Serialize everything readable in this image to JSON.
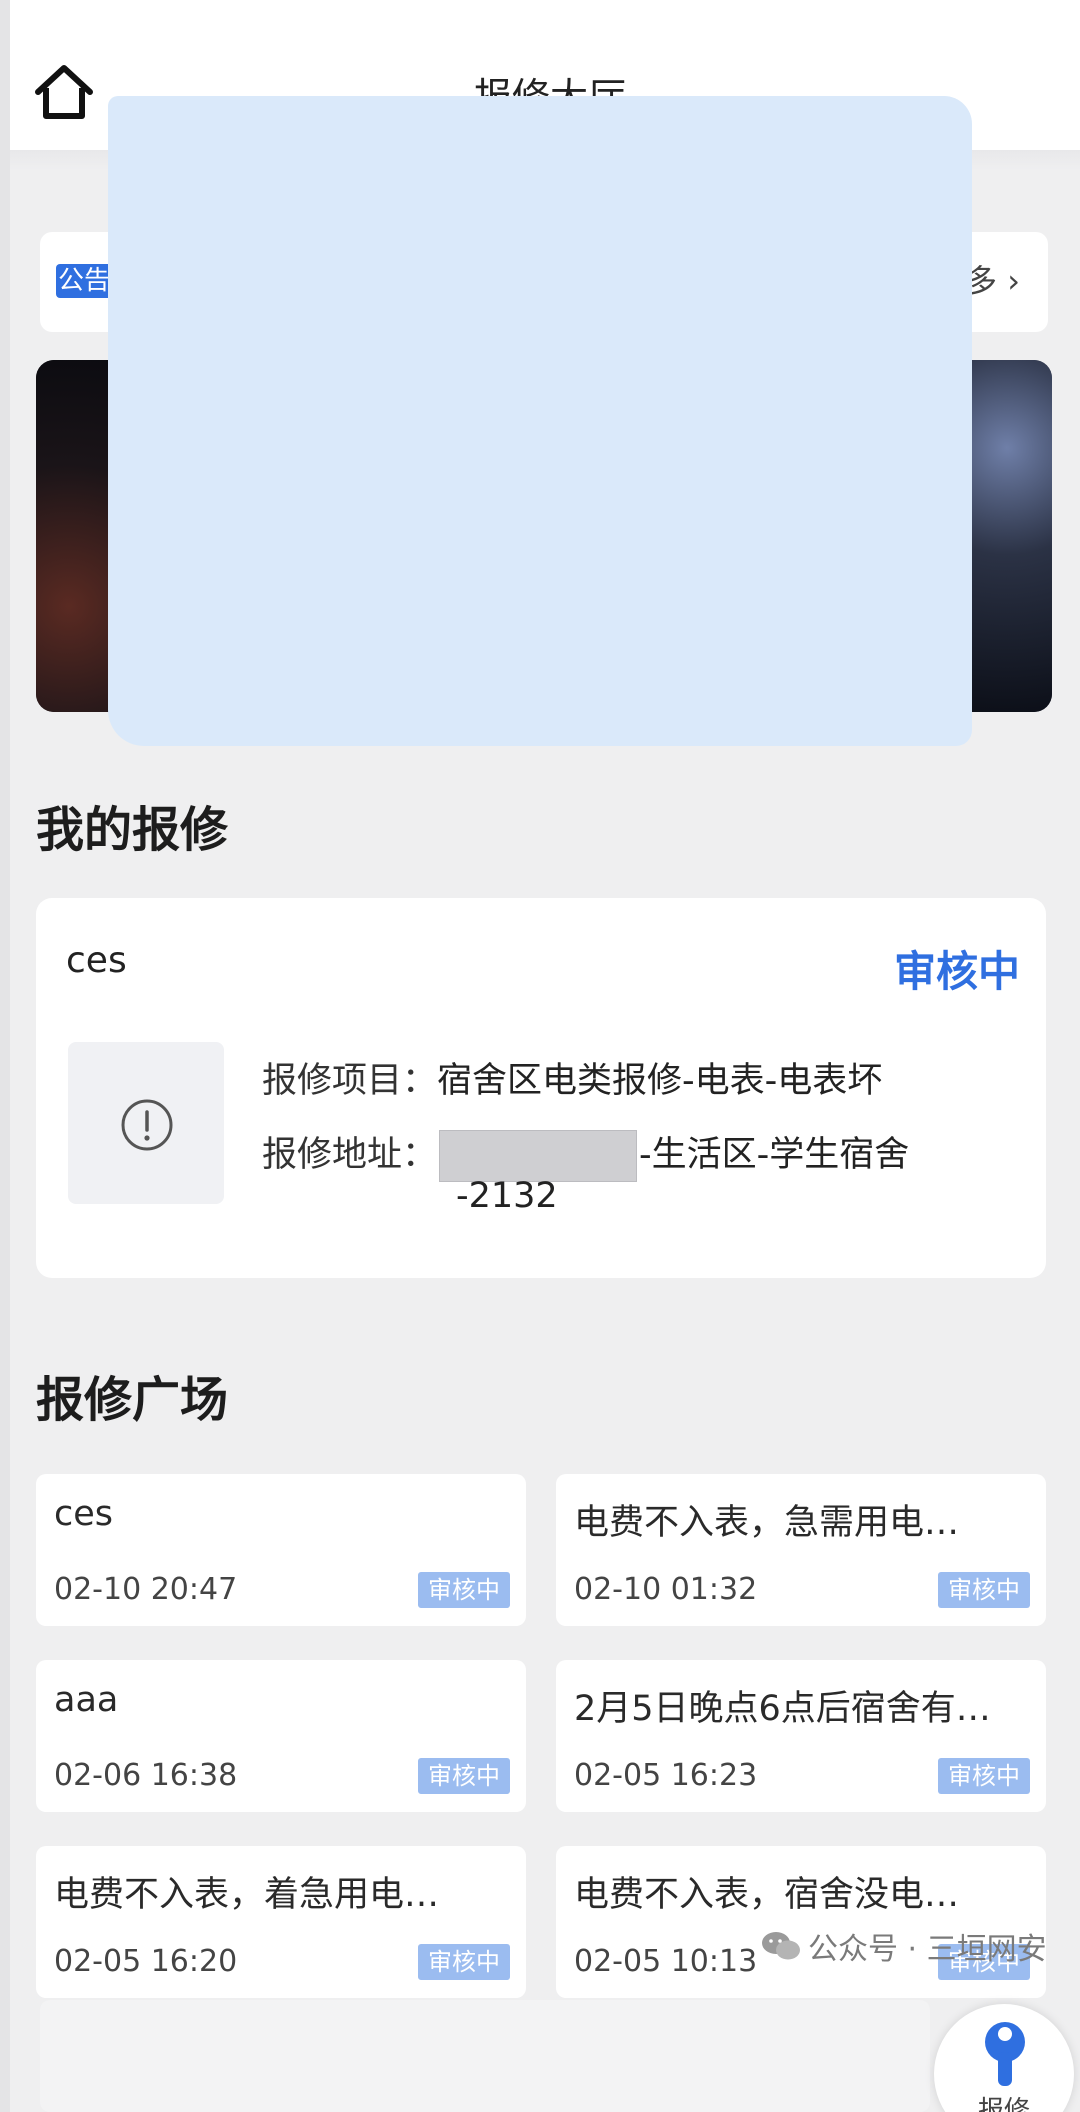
{
  "header": {
    "title": "报修大厅"
  },
  "notice": {
    "badge": "公告",
    "more": "多 ›"
  },
  "sections": {
    "my_repairs": "我的报修",
    "plaza": "报修广场"
  },
  "my_repair": {
    "name": "ces",
    "status": "审核中",
    "item_label": "报修项目：",
    "item_value": "宿舍区电类报修-电表-电表坏",
    "address_label": "报修地址：",
    "address_value": "-生活区-学生宿舍",
    "address_line2": "-2132"
  },
  "plaza": [
    {
      "title": "ces",
      "time": "02-10 20:47",
      "status": "审核中"
    },
    {
      "title": "电费不入表，急需用电…",
      "time": "02-10 01:32",
      "status": "审核中"
    },
    {
      "title": "aaa",
      "time": "02-06 16:38",
      "status": "审核中"
    },
    {
      "title": "2月5日晚点6点后宿舍有…",
      "time": "02-05 16:23",
      "status": "审核中"
    },
    {
      "title": "电费不入表，着急用电…",
      "time": "02-05 16:20",
      "status": "审核中"
    },
    {
      "title": "电费不入表，宿舍没电…",
      "time": "02-05 10:13",
      "status": "审核中"
    }
  ],
  "watermark": "公众号 · 三垣网安",
  "fab": {
    "label": "报修"
  },
  "colors": {
    "accent": "#2f6fe0",
    "badge": "#9bbcf0",
    "redaction": "#dae9fa"
  }
}
